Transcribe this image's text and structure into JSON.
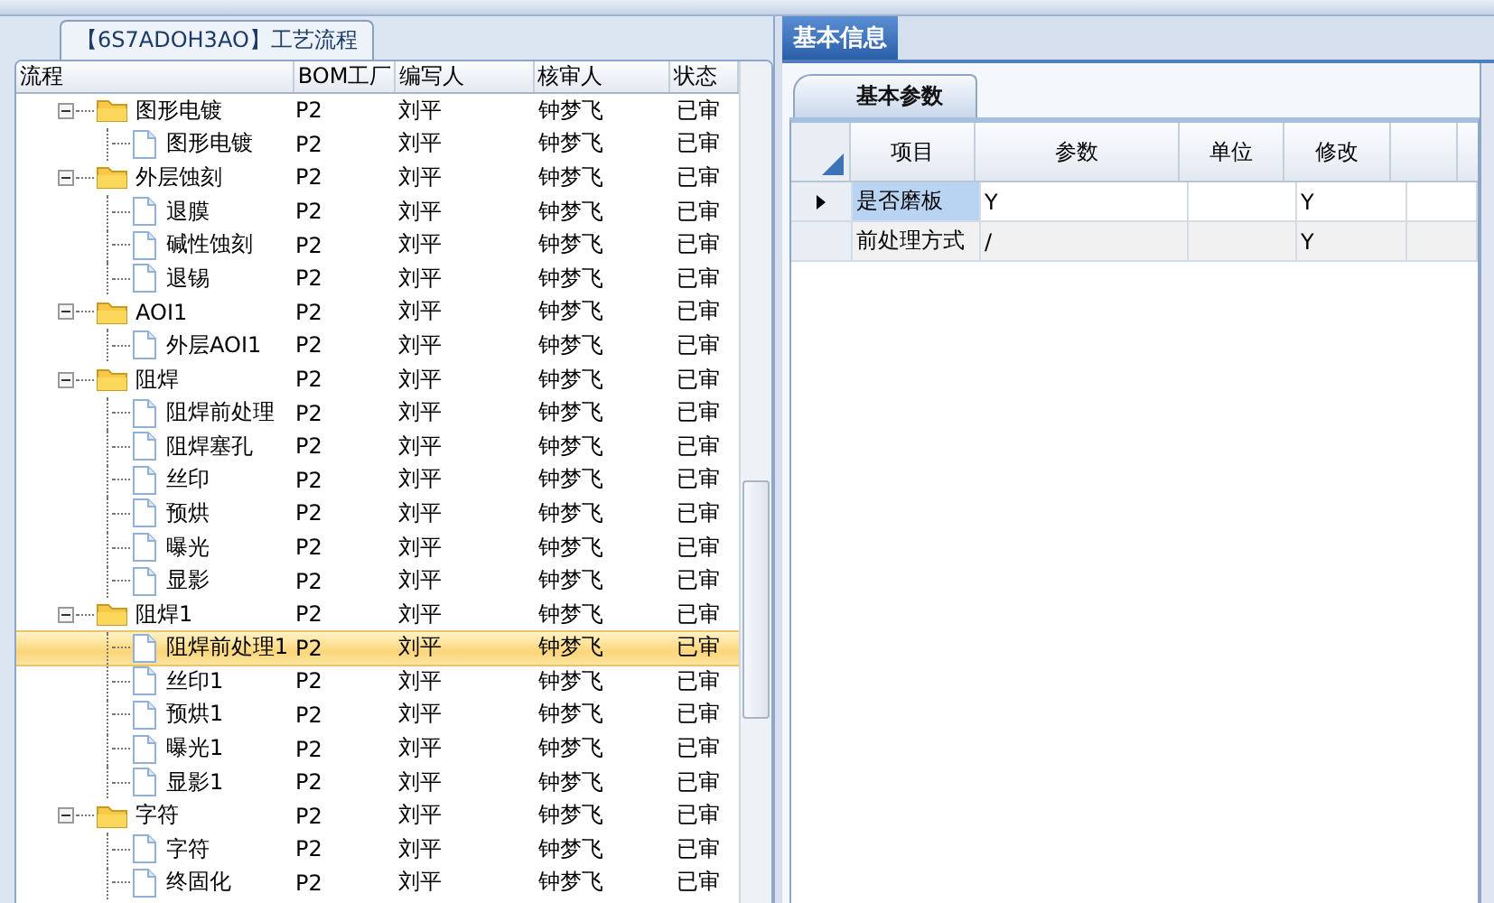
{
  "left_panel": {
    "title": "【6S7ADOH3AO】工艺流程",
    "columns": [
      "流程",
      "BOM工厂",
      "编写人",
      "核审人",
      "状态"
    ],
    "tree": [
      {
        "name": "图形电镀",
        "bom": "P2",
        "author": "刘平",
        "reviewer": "钟梦飞",
        "status": "已审",
        "expanded": true,
        "selected": false,
        "children": [
          {
            "name": "图形电镀",
            "bom": "P2",
            "author": "刘平",
            "reviewer": "钟梦飞",
            "status": "已审",
            "selected": false
          }
        ]
      },
      {
        "name": "外层蚀刻",
        "bom": "P2",
        "author": "刘平",
        "reviewer": "钟梦飞",
        "status": "已审",
        "expanded": true,
        "selected": false,
        "children": [
          {
            "name": "退膜",
            "bom": "P2",
            "author": "刘平",
            "reviewer": "钟梦飞",
            "status": "已审",
            "selected": false
          },
          {
            "name": "碱性蚀刻",
            "bom": "P2",
            "author": "刘平",
            "reviewer": "钟梦飞",
            "status": "已审",
            "selected": false
          },
          {
            "name": "退锡",
            "bom": "P2",
            "author": "刘平",
            "reviewer": "钟梦飞",
            "status": "已审",
            "selected": false
          }
        ]
      },
      {
        "name": "AOI1",
        "bom": "P2",
        "author": "刘平",
        "reviewer": "钟梦飞",
        "status": "已审",
        "expanded": true,
        "selected": false,
        "children": [
          {
            "name": "外层AOI1",
            "bom": "P2",
            "author": "刘平",
            "reviewer": "钟梦飞",
            "status": "已审",
            "selected": false
          }
        ]
      },
      {
        "name": "阻焊",
        "bom": "P2",
        "author": "刘平",
        "reviewer": "钟梦飞",
        "status": "已审",
        "expanded": true,
        "selected": false,
        "children": [
          {
            "name": "阻焊前处理",
            "bom": "P2",
            "author": "刘平",
            "reviewer": "钟梦飞",
            "status": "已审",
            "selected": false
          },
          {
            "name": "阻焊塞孔",
            "bom": "P2",
            "author": "刘平",
            "reviewer": "钟梦飞",
            "status": "已审",
            "selected": false
          },
          {
            "name": "丝印",
            "bom": "P2",
            "author": "刘平",
            "reviewer": "钟梦飞",
            "status": "已审",
            "selected": false
          },
          {
            "name": "预烘",
            "bom": "P2",
            "author": "刘平",
            "reviewer": "钟梦飞",
            "status": "已审",
            "selected": false
          },
          {
            "name": "曝光",
            "bom": "P2",
            "author": "刘平",
            "reviewer": "钟梦飞",
            "status": "已审",
            "selected": false
          },
          {
            "name": "显影",
            "bom": "P2",
            "author": "刘平",
            "reviewer": "钟梦飞",
            "status": "已审",
            "selected": false
          }
        ]
      },
      {
        "name": "阻焊1",
        "bom": "P2",
        "author": "刘平",
        "reviewer": "钟梦飞",
        "status": "已审",
        "expanded": true,
        "selected": false,
        "children": [
          {
            "name": "阻焊前处理1",
            "bom": "P2",
            "author": "刘平",
            "reviewer": "钟梦飞",
            "status": "已审",
            "selected": true
          },
          {
            "name": "丝印1",
            "bom": "P2",
            "author": "刘平",
            "reviewer": "钟梦飞",
            "status": "已审",
            "selected": false
          },
          {
            "name": "预烘1",
            "bom": "P2",
            "author": "刘平",
            "reviewer": "钟梦飞",
            "status": "已审",
            "selected": false
          },
          {
            "name": "曝光1",
            "bom": "P2",
            "author": "刘平",
            "reviewer": "钟梦飞",
            "status": "已审",
            "selected": false
          },
          {
            "name": "显影1",
            "bom": "P2",
            "author": "刘平",
            "reviewer": "钟梦飞",
            "status": "已审",
            "selected": false
          }
        ]
      },
      {
        "name": "字符",
        "bom": "P2",
        "author": "刘平",
        "reviewer": "钟梦飞",
        "status": "已审",
        "expanded": true,
        "selected": false,
        "children": [
          {
            "name": "字符",
            "bom": "P2",
            "author": "刘平",
            "reviewer": "钟梦飞",
            "status": "已审",
            "selected": false
          },
          {
            "name": "终固化",
            "bom": "P2",
            "author": "刘平",
            "reviewer": "钟梦飞",
            "status": "已审",
            "selected": false
          }
        ]
      }
    ]
  },
  "right_panel": {
    "tabs": [
      {
        "label": "基本信息",
        "selected": true
      }
    ],
    "subtabs": [
      {
        "label": "基本参数",
        "selected": true
      }
    ],
    "columns": [
      "项目",
      "参数",
      "单位",
      "修改"
    ],
    "rows": [
      {
        "cells": [
          "是否磨板",
          "Y",
          "",
          "Y"
        ],
        "selected": true
      },
      {
        "cells": [
          "前处理方式",
          "/",
          "",
          "Y"
        ],
        "selected": false
      }
    ]
  }
}
